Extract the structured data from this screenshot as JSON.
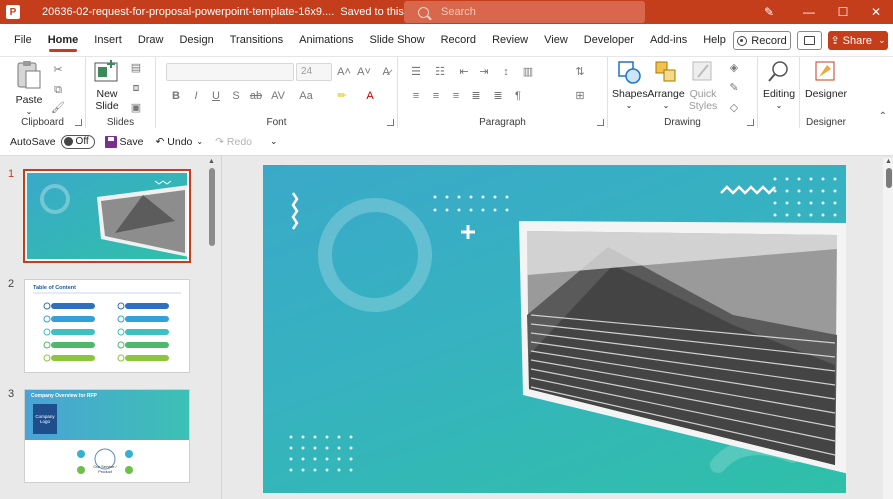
{
  "titlebar": {
    "doc_title": "20636-02-request-for-proposal-powerpoint-template-16x9....",
    "saved_status": "Saved to this PC",
    "search_placeholder": "Search",
    "minimize": "—",
    "maximize": "☐",
    "close": "✕"
  },
  "menu": {
    "tabs": [
      "File",
      "Home",
      "Insert",
      "Draw",
      "Design",
      "Transitions",
      "Animations",
      "Slide Show",
      "Record",
      "Review",
      "View",
      "Developer",
      "Add-ins",
      "Help"
    ],
    "active_tab": "Home",
    "record_label": "Record",
    "share_label": "Share"
  },
  "ribbon": {
    "clipboard": {
      "paste_label": "Paste",
      "group_label": "Clipboard"
    },
    "slides": {
      "new_slide_line1": "New",
      "new_slide_line2": "Slide",
      "group_label": "Slides"
    },
    "font": {
      "font_size": "24",
      "group_label": "Font"
    },
    "paragraph": {
      "group_label": "Paragraph"
    },
    "drawing": {
      "shapes_label": "Shapes",
      "arrange_label": "Arrange",
      "quick_styles_line1": "Quick",
      "quick_styles_line2": "Styles",
      "group_label": "Drawing"
    },
    "editing": {
      "label": "Editing"
    },
    "designer": {
      "label": "Designer",
      "group_label": "Designer"
    }
  },
  "qat": {
    "autosave_label": "AutoSave",
    "autosave_state": "Off",
    "save_label": "Save",
    "undo_label": "Undo",
    "redo_label": "Redo"
  },
  "thumbnails": [
    {
      "number": "1"
    },
    {
      "number": "2",
      "heading": "Table of Content"
    },
    {
      "number": "3",
      "heading": "Company Overview for RFP",
      "logo_text": "Company Logo",
      "center_text": "Our Service / Product"
    }
  ],
  "colors": {
    "accent": "#c43e1c",
    "slide_teal": "#36b2c0",
    "slide_green": "#2fc0a8"
  }
}
